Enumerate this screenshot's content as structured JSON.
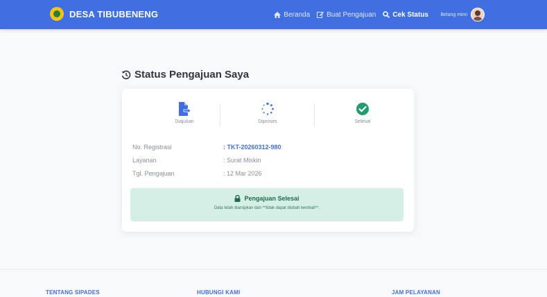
{
  "navbar": {
    "brand": "DESA TIBUBENENG",
    "links": [
      {
        "label": "Beranda",
        "icon": "home-icon"
      },
      {
        "label": "Buat Pengajuan",
        "icon": "edit-icon"
      },
      {
        "label": "Cek Status",
        "icon": "search-icon"
      }
    ],
    "user_name": "Belang mimi"
  },
  "page": {
    "title": "Status Pengajuan Saya"
  },
  "steps": [
    {
      "label": "Diajukan",
      "icon": "file-arrow-icon"
    },
    {
      "label": "Diproses",
      "icon": "spinner-icon"
    },
    {
      "label": "Selesai",
      "icon": "check-circle-icon"
    }
  ],
  "info": {
    "reg_label": "No. Registrasi",
    "reg_value": ": TKT-20260312-980",
    "service_label": "Layanan",
    "service_value": ": Surat Miskin",
    "date_label": "Tgl. Pengajuan",
    "date_value": ": 12 Mar 2026"
  },
  "alert": {
    "title": "Pengajuan Selesai",
    "text": "Data telah diarsipkan dan **tidak dapat diubah kembali**."
  },
  "footer": {
    "about": "TENTANG SIPADES",
    "contact": "HUBUNGI KAMI",
    "hours": "JAM PELAYANAN"
  },
  "colors": {
    "primary": "#3f6fe0",
    "success": "#1f9d6b",
    "alert_bg": "#d5efe6"
  }
}
